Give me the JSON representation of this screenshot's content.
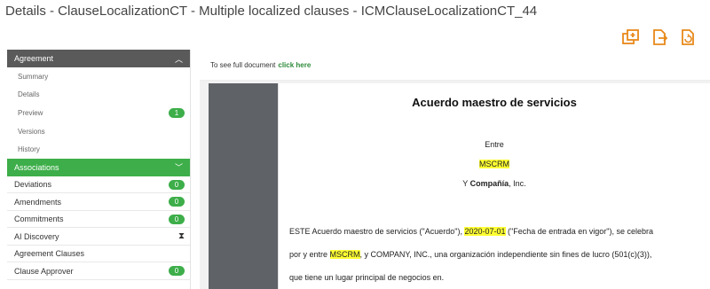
{
  "page": {
    "title": "Details - ClauseLocalizationCT - Multiple localized clauses - ICMClauseLocalizationCT_44"
  },
  "toolbar": {
    "icons": [
      "copy-add-icon",
      "document-export-icon",
      "document-refresh-icon"
    ]
  },
  "sidebar": {
    "agreement_header": "Agreement",
    "agreement_items": [
      {
        "label": "Summary"
      },
      {
        "label": "Details"
      },
      {
        "label": "Preview",
        "badge": "1"
      },
      {
        "label": "Versions"
      },
      {
        "label": "History"
      }
    ],
    "associations_header": "Associations",
    "association_items": [
      {
        "label": "Deviations",
        "badge": "0"
      },
      {
        "label": "Amendments",
        "badge": "0"
      },
      {
        "label": "Commitments",
        "badge": "0"
      },
      {
        "label": "AI Discovery",
        "icon": "hourglass-icon"
      },
      {
        "label": "Agreement Clauses"
      },
      {
        "label": "Clause Approver",
        "badge": "0"
      }
    ]
  },
  "main": {
    "full_doc_prefix": "To see full document",
    "full_doc_link": "click here",
    "doc": {
      "title": "Acuerdo maestro de servicios",
      "entre": "Entre",
      "party1": "MSCRM",
      "y_prefix": "Y",
      "party2_bold": "Compañía",
      "party2_suffix": ", Inc.",
      "para_l1_a": "ESTE Acuerdo maestro de servicios (\"Acuerdo\"),",
      "para_l1_date": "2020-07-01",
      "para_l1_b": "(\"Fecha de entrada en vigor\"), se celebra",
      "para_l2_a": "por y entre",
      "para_l2_hl": "MSCRM",
      "para_l2_b": ", y COMPANY, INC., una organización independiente sin fines de lucro (501(c)(3)),",
      "para_l3": "que tiene un lugar principal de negocios en."
    }
  },
  "colors": {
    "accent_green": "#3dae49",
    "dark_header": "#5a5a5a",
    "highlight": "#ffff33",
    "icon_orange": "#e8891a"
  }
}
